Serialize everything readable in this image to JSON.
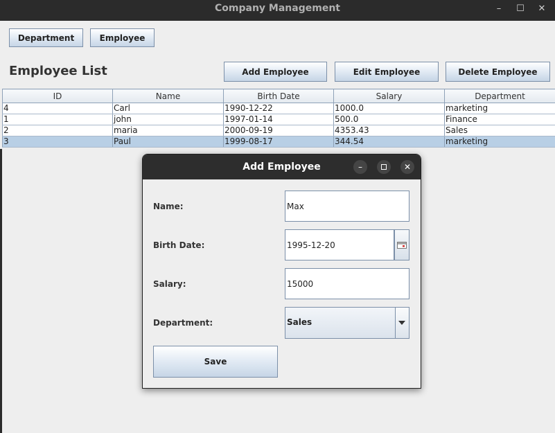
{
  "window": {
    "title": "Company Management",
    "minimize_glyph": "–",
    "maximize_glyph": "☐",
    "close_glyph": "✕"
  },
  "nav": {
    "department_label": "Department",
    "employee_label": "Employee"
  },
  "page": {
    "heading": "Employee List",
    "add_label": "Add Employee",
    "edit_label": "Edit Employee",
    "delete_label": "Delete Employee"
  },
  "table": {
    "columns": [
      "ID",
      "Name",
      "Birth Date",
      "Salary",
      "Department"
    ],
    "rows": [
      {
        "id": "4",
        "name": "Carl",
        "birth": "1990-12-22",
        "salary": "1000.0",
        "dept": "marketing"
      },
      {
        "id": "1",
        "name": "john",
        "birth": "1997-01-14",
        "salary": "500.0",
        "dept": "Finance"
      },
      {
        "id": "2",
        "name": "maria",
        "birth": "2000-09-19",
        "salary": "4353.43",
        "dept": "Sales"
      },
      {
        "id": "3",
        "name": "Paul",
        "birth": "1999-08-17",
        "salary": "344.54",
        "dept": "marketing"
      }
    ],
    "selected_row_index": 3,
    "selection_color": "#b8cfe5"
  },
  "dialog": {
    "title": "Add Employee",
    "name_label": "Name:",
    "name_value": "Max",
    "birth_label": "Birth Date:",
    "birth_value": "1995-12-20",
    "salary_label": "Salary:",
    "salary_value": "15000",
    "department_label": "Department:",
    "department_value": "Sales",
    "save_label": "Save",
    "icons": {
      "calendar": "calendar-icon",
      "dropdown": "chevron-down-icon"
    }
  }
}
